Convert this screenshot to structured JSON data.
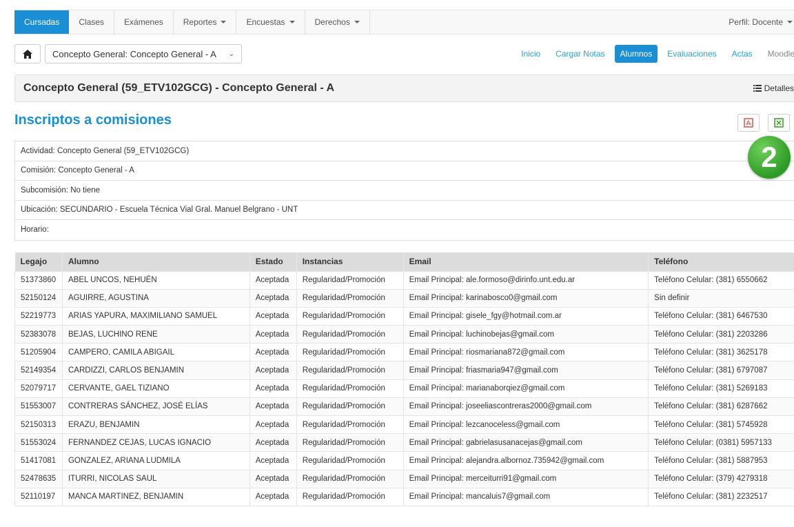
{
  "nav": {
    "items": [
      {
        "label": "Cursadas",
        "active": true,
        "caret": false
      },
      {
        "label": "Clases",
        "active": false,
        "caret": false
      },
      {
        "label": "Exámenes",
        "active": false,
        "caret": false
      },
      {
        "label": "Reportes",
        "active": false,
        "caret": true
      },
      {
        "label": "Encuestas",
        "active": false,
        "caret": true
      },
      {
        "label": "Derechos",
        "active": false,
        "caret": true
      }
    ],
    "profile": "Perfil: Docente"
  },
  "toolbar": {
    "course_select": "Concepto General: Concepto General - A",
    "tabs": [
      {
        "label": "Inicio",
        "active": false
      },
      {
        "label": "Cargar Notas",
        "active": false
      },
      {
        "label": "Alumnos",
        "active": true
      },
      {
        "label": "Evaluaciones",
        "active": false
      },
      {
        "label": "Actas",
        "active": false
      },
      {
        "label": "Moodle",
        "active": false,
        "muted": true
      }
    ]
  },
  "header": {
    "title": "Concepto General (59_ETV102GCG) - Concepto General - A",
    "details_label": "Detalles"
  },
  "section": {
    "title": "Inscriptos a comisiones",
    "badge": "2"
  },
  "info": {
    "lines": [
      "Actividad: Concepto General (59_ETV102GCG)",
      "Comisión: Concepto General - A",
      "Subcomisión: No tiene",
      "Ubicación: SECUNDARIO - Escuela Técnica Vial Gral. Manuel Belgrano - UNT",
      "Horario:"
    ]
  },
  "table": {
    "headers": [
      "Legajo",
      "Alumno",
      "Estado",
      "Instancias",
      "Email",
      "Teléfono"
    ],
    "rows": [
      [
        "51373860",
        "ABEL UNCOS, NEHUÉN",
        "Aceptada",
        "Regularidad/Promoción",
        "Email Principal: ale.formoso@dirinfo.unt.edu.ar",
        "Teléfono Celular: (381) 6550662"
      ],
      [
        "52150124",
        "AGUIRRE, AGUSTINA",
        "Aceptada",
        "Regularidad/Promoción",
        "Email Principal: karinabosco0@gmail.com",
        "Sin definir"
      ],
      [
        "52219773",
        "ARIAS YAPURA, MAXIMILIANO SAMUEL",
        "Aceptada",
        "Regularidad/Promoción",
        "Email Principal: gisele_fgy@hotmail.com.ar",
        "Teléfono Celular: (381) 6467530"
      ],
      [
        "52383078",
        "BEJAS, LUCHINO RENE",
        "Aceptada",
        "Regularidad/Promoción",
        "Email Principal: luchinobejas@gmail.com",
        "Teléfono Celular: (381) 2203286"
      ],
      [
        "51205904",
        "CAMPERO, CAMILA ABIGAIL",
        "Aceptada",
        "Regularidad/Promoción",
        "Email Principal: riosmariana872@gmail.com",
        "Teléfono Celular: (381) 3625178"
      ],
      [
        "52149354",
        "CARDIZZI, CARLOS BENJAMIN",
        "Aceptada",
        "Regularidad/Promoción",
        "Email Principal: friasmaria947@gmail.com",
        "Teléfono Celular: (381) 6797087"
      ],
      [
        "52079717",
        "CERVANTE, GAEL TIZIANO",
        "Aceptada",
        "Regularidad/Promoción",
        "Email Principal: marianaborqiez@gmail.com",
        "Teléfono Celular: (381) 5269183"
      ],
      [
        "51553007",
        "CONTRERAS SÁNCHEZ, JOSÉ ELÍAS",
        "Aceptada",
        "Regularidad/Promoción",
        "Email Principal: joseeliascontreras2000@gmail.com",
        "Teléfono Celular: (381) 6287662"
      ],
      [
        "52150313",
        "ERAZU, BENJAMIN",
        "Aceptada",
        "Regularidad/Promoción",
        "Email Principal: lezcanoceless@gmail.com",
        "Teléfono Celular: (381) 5745928"
      ],
      [
        "51553024",
        "FERNANDEZ CEJAS, LUCAS IGNACIO",
        "Aceptada",
        "Regularidad/Promoción",
        "Email Principal: gabrielasusanacejas@gmail.com",
        "Teléfono Celular: (0381) 5957133"
      ],
      [
        "51417081",
        "GONZALEZ, ARIANA LUDMILA",
        "Aceptada",
        "Regularidad/Promoción",
        "Email Principal: alejandra.albornoz.735942@gmail.com",
        "Teléfono Celular: (381) 5887953"
      ],
      [
        "52478635",
        "ITURRI, NICOLAS SAUL",
        "Aceptada",
        "Regularidad/Promoción",
        "Email Principal: merceiturri91@gmail.com",
        "Teléfono Celular: (379) 4279318"
      ],
      [
        "52110197",
        "MANCA MARTINEZ, BENJAMIN",
        "Aceptada",
        "Regularidad/Promoción",
        "Email Principal: mancaluis7@gmail.com",
        "Teléfono Celular: (381) 2232517"
      ]
    ]
  }
}
